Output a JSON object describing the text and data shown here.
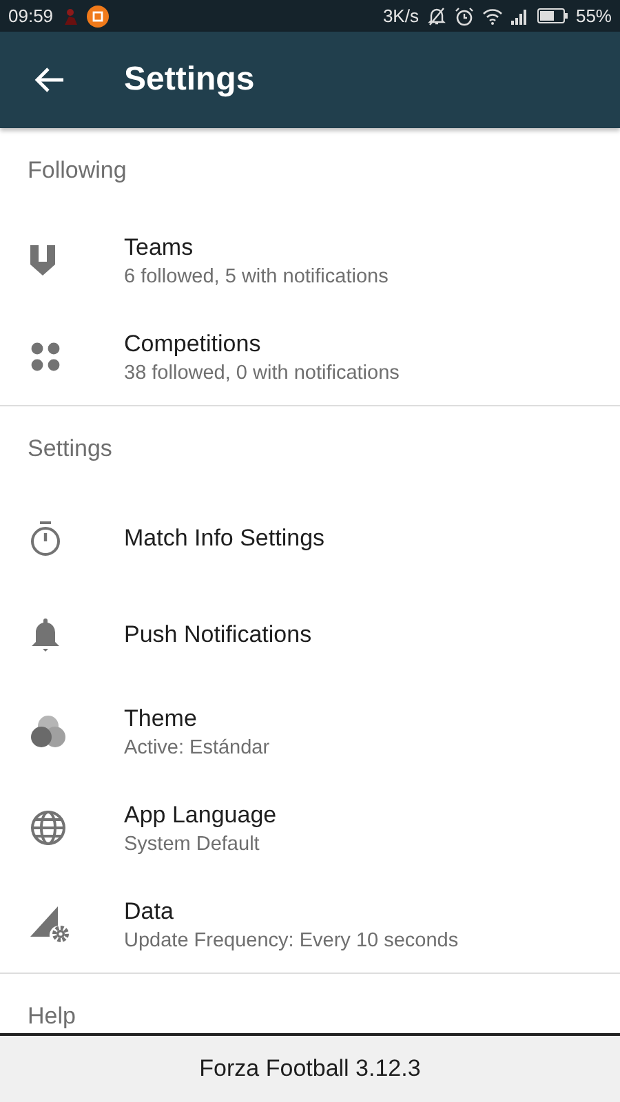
{
  "status_bar": {
    "time": "09:59",
    "speed": "3K/s",
    "battery": "55%"
  },
  "app_bar": {
    "title": "Settings"
  },
  "sections": [
    {
      "header": "Following",
      "items": [
        {
          "title": "Teams",
          "subtitle": "6 followed, 5 with notifications"
        },
        {
          "title": "Competitions",
          "subtitle": "38 followed, 0 with notifications"
        }
      ]
    },
    {
      "header": "Settings",
      "items": [
        {
          "title": "Match Info Settings"
        },
        {
          "title": "Push Notifications"
        },
        {
          "title": "Theme",
          "subtitle": "Active: Estándar"
        },
        {
          "title": "App Language",
          "subtitle": "System Default"
        },
        {
          "title": "Data",
          "subtitle": "Update Frequency: Every 10 seconds"
        }
      ]
    },
    {
      "header": "Help"
    }
  ],
  "footer": {
    "text": "Forza Football 3.12.3"
  }
}
